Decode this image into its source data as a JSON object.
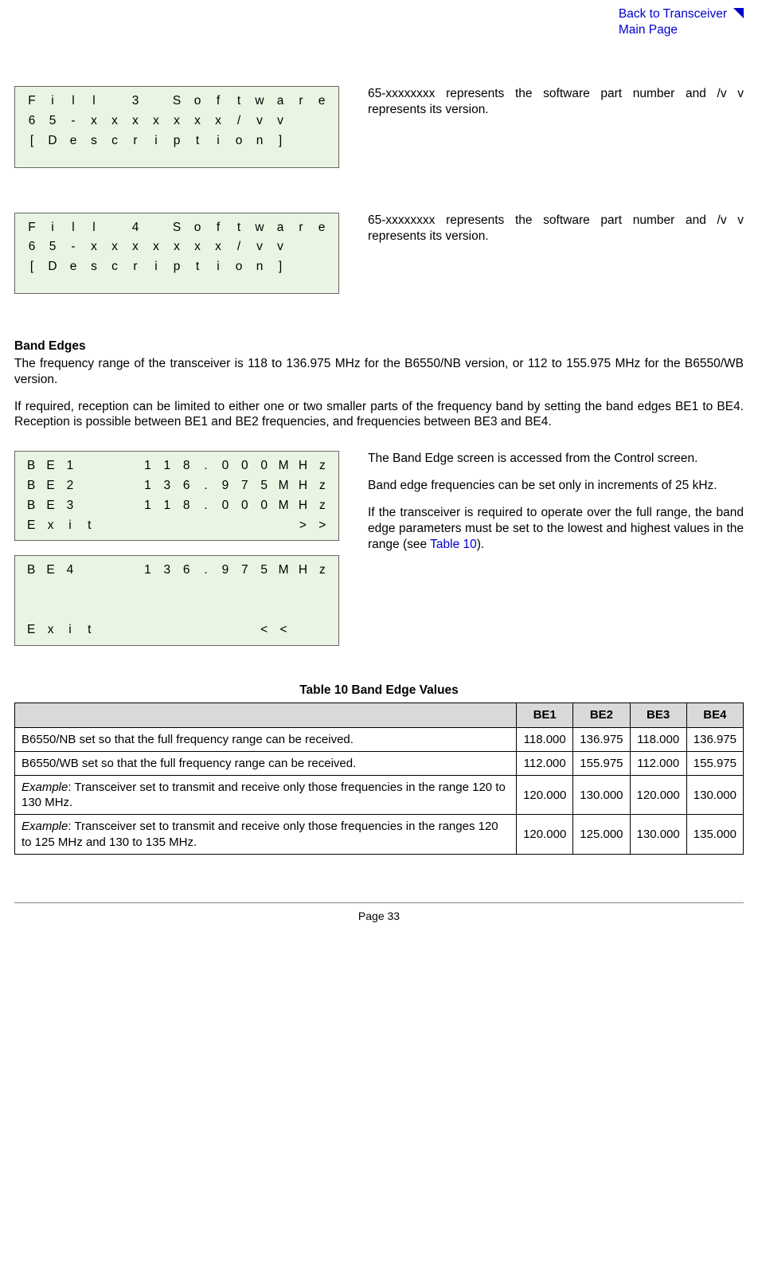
{
  "header": {
    "back_link_line1": "Back to Transceiver",
    "back_link_line2": "Main Page"
  },
  "lcd1": {
    "l1": [
      "F",
      "i",
      "l",
      "l",
      "",
      "3",
      "",
      "S",
      "o",
      "f",
      "t",
      "w",
      "a",
      "r",
      "e"
    ],
    "l2": [
      "6",
      "5",
      "-",
      "x",
      "x",
      "x",
      "x",
      "x",
      "x",
      "x",
      "/",
      "v",
      "v",
      "",
      ""
    ],
    "l3": [
      "[",
      "D",
      "e",
      "s",
      "c",
      "r",
      "i",
      "p",
      "t",
      "i",
      "o",
      "n",
      "]",
      "",
      ""
    ]
  },
  "lcd1_desc": "65-xxxxxxxx represents the software part number and /v v represents its version.",
  "lcd2": {
    "l1": [
      "F",
      "i",
      "l",
      "l",
      "",
      "4",
      "",
      "S",
      "o",
      "f",
      "t",
      "w",
      "a",
      "r",
      "e"
    ],
    "l2": [
      "6",
      "5",
      "-",
      "x",
      "x",
      "x",
      "x",
      "x",
      "x",
      "x",
      "/",
      "v",
      "v",
      "",
      ""
    ],
    "l3": [
      "[",
      "D",
      "e",
      "s",
      "c",
      "r",
      "i",
      "p",
      "t",
      "i",
      "o",
      "n",
      "]",
      "",
      ""
    ]
  },
  "lcd2_desc": "65-xxxxxxxx represents the software part number and /v v represents its version.",
  "section": {
    "title": "Band Edges",
    "p1": "The frequency range of the transceiver is 118 to 136.975 MHz for the B6550/NB version, or 112 to 155.975 MHz for the B6550/WB version.",
    "p2": "If required, reception can be limited to either one or two smaller parts of the frequency band by setting the band edges BE1 to BE4. Reception is possible between BE1 and BE2 frequencies, and frequencies between BE3 and BE4."
  },
  "lcd3": {
    "l1": [
      "B",
      "E",
      "1",
      "",
      "",
      "",
      "1",
      "1",
      "8",
      ".",
      "0",
      "0",
      "0",
      "M",
      "H",
      "z"
    ],
    "l2": [
      "B",
      "E",
      "2",
      "",
      "",
      "",
      "1",
      "3",
      "6",
      ".",
      "9",
      "7",
      "5",
      "M",
      "H",
      "z"
    ],
    "l3": [
      "B",
      "E",
      "3",
      "",
      "",
      "",
      "1",
      "1",
      "8",
      ".",
      "0",
      "0",
      "0",
      "M",
      "H",
      "z"
    ],
    "l4": [
      "E",
      "x",
      "i",
      "t",
      "",
      "",
      "",
      "",
      "",
      "",
      "",
      "",
      "",
      "",
      ">",
      ">"
    ]
  },
  "lcd4": {
    "l1": [
      "B",
      "E",
      "4",
      "",
      "",
      "",
      "1",
      "3",
      "6",
      ".",
      "9",
      "7",
      "5",
      "M",
      "H",
      "z"
    ],
    "l2": [
      "",
      "",
      "",
      "",
      "",
      "",
      "",
      "",
      "",
      "",
      "",
      "",
      "",
      "",
      "",
      ""
    ],
    "l3": [
      "",
      "",
      "",
      "",
      "",
      "",
      "",
      "",
      "",
      "",
      "",
      "",
      "",
      "",
      "",
      ""
    ],
    "l4": [
      "E",
      "x",
      "i",
      "t",
      "",
      "",
      "",
      "",
      "",
      "",
      "",
      "",
      "<",
      "<",
      "",
      ""
    ]
  },
  "band_desc": {
    "p1": "The Band Edge screen is accessed from the Control screen.",
    "p2": "Band edge frequencies can be set only in increments of 25 kHz.",
    "p3_a": "If the transceiver is required to operate over the full range, the band edge parameters must be set to the lowest and highest values in the range (see ",
    "p3_link": "Table 10",
    "p3_b": ")."
  },
  "table": {
    "title": "Table 10 Band Edge Values",
    "headers": [
      "BE1",
      "BE2",
      "BE3",
      "BE4"
    ],
    "rows": [
      {
        "label_plain": "B6550/NB set so that the full frequency range can be received.",
        "vals": [
          "118.000",
          "136.975",
          "118.000",
          "136.975"
        ]
      },
      {
        "label_plain": "B6550/WB set so that the full frequency range can be received.",
        "vals": [
          "112.000",
          "155.975",
          "112.000",
          "155.975"
        ]
      },
      {
        "label_italic": "Example",
        "label_rest": ": Transceiver set to transmit and receive only those frequencies in the range 120 to 130 MHz.",
        "vals": [
          "120.000",
          "130.000",
          "120.000",
          "130.000"
        ]
      },
      {
        "label_italic": "Example",
        "label_rest": ": Transceiver set to transmit and receive only those frequencies in the ranges 120 to 125 MHz and 130 to 135 MHz.",
        "vals": [
          "120.000",
          "125.000",
          "130.000",
          "135.000"
        ]
      }
    ]
  },
  "footer": "Page 33"
}
